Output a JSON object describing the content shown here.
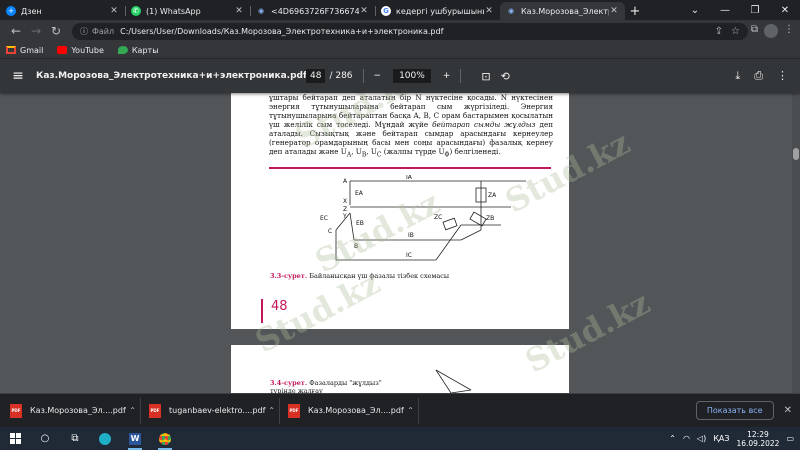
{
  "tabs": [
    {
      "title": "Дзен",
      "fav": "+",
      "fav_color": "#0a84ff"
    },
    {
      "title": "(1) WhatsApp",
      "fav": "✆",
      "fav_color": "#25d366"
    },
    {
      "title": "<4D6963726F736674205",
      "fav": "◉",
      "fav_color": "#8ab4f8"
    },
    {
      "title": "кедергі ушбурышының жә",
      "fav": "G",
      "fav_color": "#4285f4"
    },
    {
      "title": "Каз.Морозова_Электроте",
      "fav": "◉",
      "fav_color": "#8ab4f8"
    }
  ],
  "address": {
    "info": "ⓘ",
    "scheme": "Файл",
    "url": "C:/Users/User/Downloads/Каз.Морозова_Электротехника+и+электроника.pdf"
  },
  "bookmarks": [
    {
      "label": "Gmail",
      "color": "#ea4335"
    },
    {
      "label": "YouTube",
      "color": "#ff0000"
    },
    {
      "label": "Карты",
      "color": "#34a853"
    }
  ],
  "pdf": {
    "filename": "Каз.Морозова_Электротехника+и+электроника.pdf",
    "page": "48",
    "page_total": "/ 286",
    "zoom": "100%"
  },
  "page1": {
    "p1": "ұштары бейтарап деп аталатын бір N нүктесіне қосады. N нүктесінен энергия тұтынушыларына бейтарап сым жүргізіледі. Энергия тұтынушыларына бейтараптан басқа A, B, C орам бастарымен қосылатын үш желілік сым тоселеді. Мұндай жүйе",
    "p1_em": "бейтарап сымды жұлдыз",
    "p1_rest": "деп аталады. Сызықтық және бейтарап сымдар арасындағы кернеулер (генератор орамдарының басы мен соңы арасындағы) фазалық кернеу деп аталады және U",
    "p1_end": "(жалпы түрде U",
    "p1_tail": ") белгіленеді.",
    "caption_num": "3.3-сурет.",
    "caption_text": "Байланысқан үш фазалы тізбек схемасы",
    "page_number": "48"
  },
  "page2": {
    "caption_num": "3.4-сурет.",
    "caption_text": "Фазаларды \"жұлдыз\" түрінде жалғау"
  },
  "diagram_labels": {
    "A": "A",
    "X": "X",
    "Z": "Z",
    "Y": "Y",
    "C": "C",
    "B": "B",
    "EA": "EA",
    "EB": "EB",
    "EC": "EC",
    "IA": "IA",
    "IB": "IB",
    "IC": "IC",
    "ZA": "ZA",
    "ZB": "ZB",
    "ZC": "ZC"
  },
  "watermark": "Stud.kz",
  "downloads": [
    {
      "name": "Каз.Морозова_Эл....pdf"
    },
    {
      "name": "tuganbaev-elektro....pdf"
    },
    {
      "name": "Каз.Морозова_Эл....pdf"
    }
  ],
  "show_all": "Показать все",
  "tray": {
    "lang": "ҚАЗ",
    "time": "12:29",
    "date": "16.09.2022"
  }
}
